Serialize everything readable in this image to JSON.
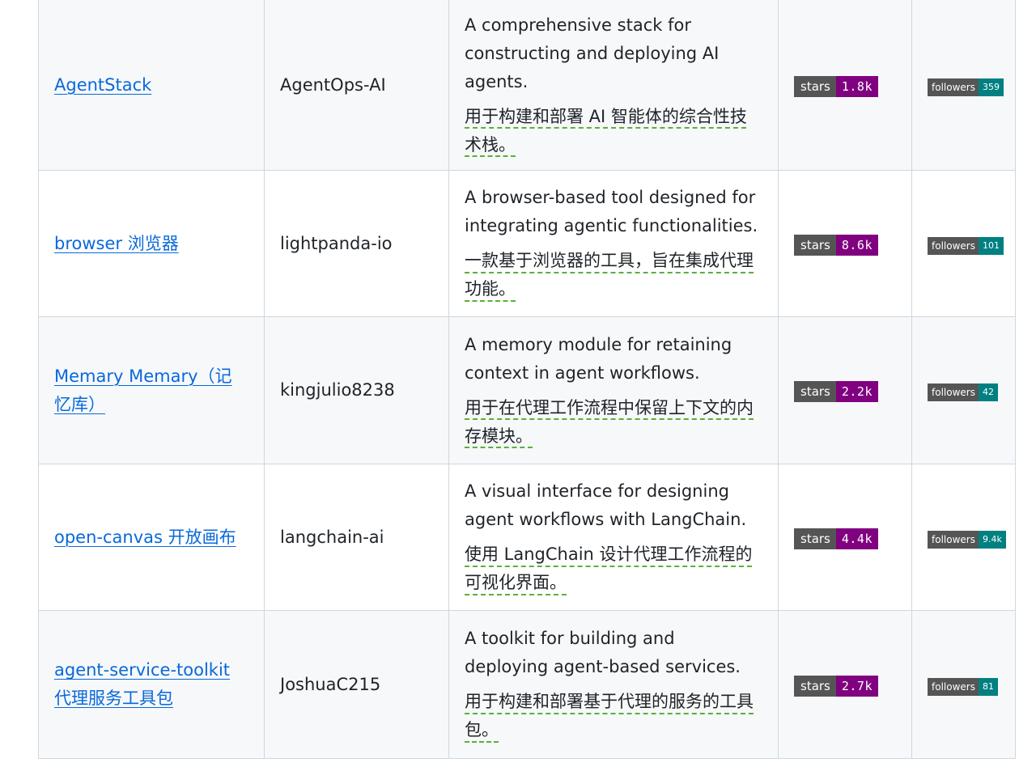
{
  "colors": {
    "link": "#0969da",
    "stars_value_bg": "#800080",
    "followers_value_bg": "#008080",
    "badge_label_bg": "#555555",
    "border": "#d0d7de",
    "zebra_bg": "#f6f8fa",
    "dashed_underline": "#59b135"
  },
  "rows": [
    {
      "name": "AgentStack",
      "owner": "AgentOps-AI",
      "desc_en": "A comprehensive stack for constructing and deploying AI agents.",
      "desc_zh": "用于构建和部署 AI 智能体的综合性技术栈。",
      "stars_label": "stars",
      "stars": "1.8k",
      "followers_label": "followers",
      "followers": "359"
    },
    {
      "name": "browser  浏览器",
      "owner": "lightpanda-io",
      "desc_en": "A browser-based tool designed for integrating agentic functionalities.",
      "desc_zh": "一款基于浏览器的工具，旨在集成代理功能。",
      "stars_label": "stars",
      "stars": "8.6k",
      "followers_label": "followers",
      "followers": "101"
    },
    {
      "name": "Memary  Memary（记忆库）",
      "owner": "kingjulio8238",
      "desc_en": "A memory module for retaining context in agent workflows.",
      "desc_zh": "用于在代理工作流程中保留上下文的内存模块。",
      "stars_label": "stars",
      "stars": "2.2k",
      "followers_label": "followers",
      "followers": "42"
    },
    {
      "name": "open-canvas  开放画布",
      "owner": "langchain-ai",
      "desc_en": "A visual interface for designing agent workflows with LangChain.",
      "desc_zh": "使用 LangChain 设计代理工作流程的可视化界面。",
      "stars_label": "stars",
      "stars": "4.4k",
      "followers_label": "followers",
      "followers": "9.4k"
    },
    {
      "name": "agent-service-toolkit  代理服务工具包",
      "owner": "JoshuaC215",
      "desc_en": "A toolkit for building and deploying agent-based services.",
      "desc_zh": "用于构建和部署基于代理的服务的工具包。",
      "stars_label": "stars",
      "stars": "2.7k",
      "followers_label": "followers",
      "followers": "81"
    }
  ]
}
